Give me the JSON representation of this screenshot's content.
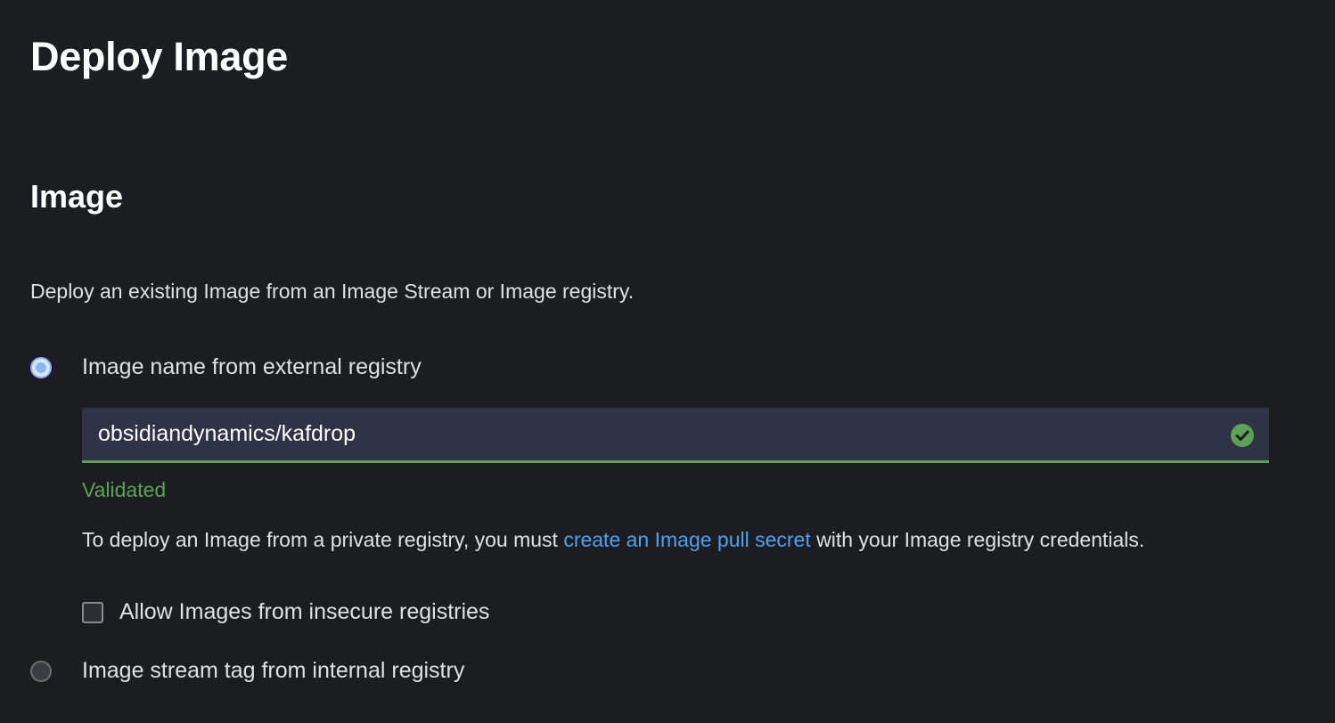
{
  "header": {
    "title": "Deploy Image"
  },
  "image_section": {
    "title": "Image",
    "description": "Deploy an existing Image from an Image Stream or Image registry.",
    "option_external": {
      "label": "Image name from external registry",
      "selected": true
    },
    "image_name_input": {
      "value": "obsidiandynamics/kafdrop",
      "status_icon": "check-circle-icon",
      "status_color": "#5ba352"
    },
    "validation_text": "Validated",
    "helper": {
      "prefix": "To deploy an Image from a private registry, you must ",
      "link": "create an Image pull secret",
      "suffix": " with your Image registry credentials."
    },
    "insecure_checkbox": {
      "label": "Allow Images from insecure registries",
      "checked": false
    },
    "option_internal": {
      "label": "Image stream tag from internal registry",
      "selected": false
    }
  },
  "colors": {
    "background": "#1b1d21",
    "accent_link": "#4ea1f0",
    "success": "#5ba352",
    "input_bg": "#2e3445"
  }
}
